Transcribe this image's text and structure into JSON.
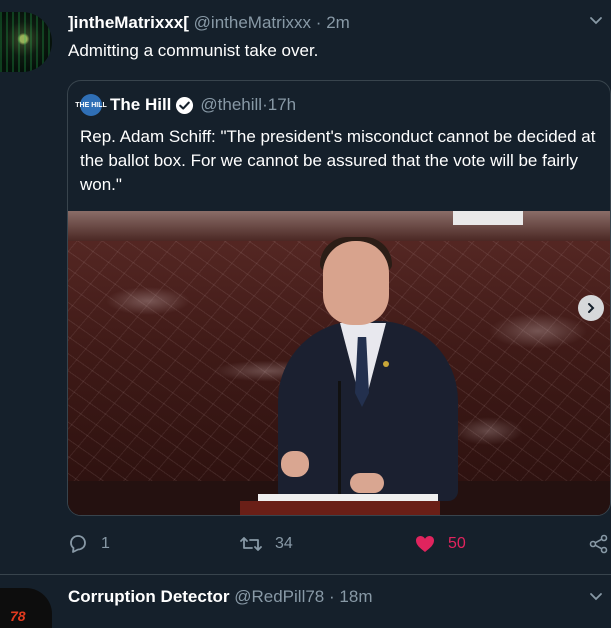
{
  "tweet": {
    "display_name": "]intheMatrixxx[",
    "handle": "@intheMatrixxx",
    "separator": "·",
    "time": "2m",
    "text": "Admitting a communist take over.",
    "avatar_icon": "matrix-avatar"
  },
  "quote": {
    "display_name": "The Hill",
    "handle": "@thehill",
    "separator": "·",
    "time": "17h",
    "logo_text": "THE HILL",
    "verified_icon": "verified-badge-icon",
    "text": "Rep. Adam Schiff: \"The president's misconduct cannot be decided at the ballot box. For we cannot be assured that the vote will be fairly won.\"",
    "media_icon": "video-thumbnail"
  },
  "actions": {
    "reply_count": "1",
    "retweet_count": "34",
    "like_count": "50",
    "like_color": "#e0245e"
  },
  "next_tweet": {
    "display_name": "Corruption Detector",
    "handle": "@RedPill78",
    "separator": "·",
    "time": "18m",
    "avatar_text": "78"
  },
  "colors": {
    "background": "#15202b",
    "secondary_text": "#8899a6",
    "border": "#38444d",
    "accent": "#1da1f2"
  }
}
